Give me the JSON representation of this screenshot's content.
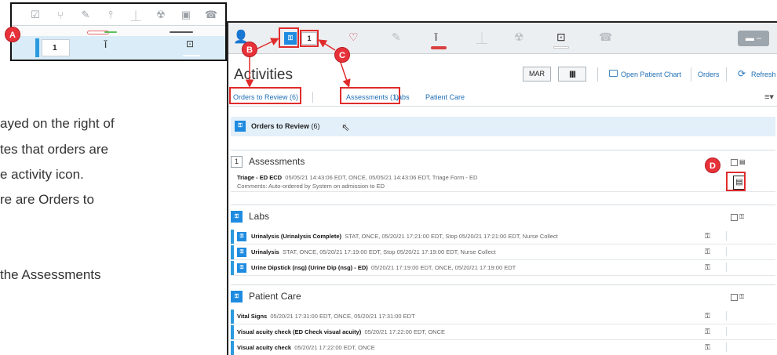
{
  "inset": {
    "count": "1"
  },
  "callouts": {
    "a": "A",
    "b": "B",
    "c": "C",
    "d": "D"
  },
  "body_text": {
    "line1": "ayed on the right of",
    "line2": "tes that orders are",
    "line3": "e activity icon.",
    "line4": "re are Orders to",
    "line5": "the Assessments"
  },
  "banner": {
    "count": "1",
    "menu_label": "▬ –"
  },
  "header": {
    "title": "Activities",
    "mar_label": "MAR",
    "barcode_label": "|||||",
    "open_chart_label": "Open Patient Chart",
    "orders_label": "Orders",
    "refresh_label": "Refresh"
  },
  "tabs": {
    "orders_to_review": "Orders to Review (6)",
    "assessments": "Assessments (1)",
    "labs": "Labs",
    "patient_care": "Patient Care"
  },
  "review_row": {
    "label": "Orders to Review",
    "count": "(6)"
  },
  "assessments": {
    "heading": "Assessments",
    "count": "1",
    "item_name": "Triage - ED ECD",
    "item_detail": "05/05/21 14:43:06 EDT, ONCE, 05/05/21 14:43:06 EDT, Triage Form - ED",
    "item_comments": "Comments: Auto-ordered by System on admission to ED"
  },
  "labs": {
    "heading": "Labs",
    "items": [
      {
        "name": "Urinalysis (Urinalysis Complete)",
        "detail": "STAT, ONCE, 05/20/21 17:21:00 EDT, Stop 05/20/21 17:21:00 EDT, Nurse Collect"
      },
      {
        "name": "Urinalysis",
        "detail": "STAT, ONCE, 05/20/21 17:19:00 EDT, Stop 05/20/21 17:19:00 EDT, Nurse Collect"
      },
      {
        "name": "Urine Dipstick (nsg) (Urine Dip (nsg) - ED)",
        "detail": "05/20/21 17:19:00 EDT, ONCE, 05/20/21 17:19:00 EDT"
      }
    ]
  },
  "patient_care": {
    "heading": "Patient Care",
    "items": [
      {
        "name": "Vital Signs",
        "detail": "05/20/21 17:31:00 EDT, ONCE, 05/20/21 17:31:00 EDT"
      },
      {
        "name": "Visual acuity check (ED Check visual acuity)",
        "detail": "05/20/21 17:22:00 EDT, ONCE"
      },
      {
        "name": "Visual acuity check",
        "detail": "05/20/21 17:22:00 EDT, ONCE"
      }
    ]
  },
  "colors": {
    "accent_blue": "#1e8be0",
    "callout_red": "#e8323a",
    "highlight_red": "#e02b2b"
  }
}
